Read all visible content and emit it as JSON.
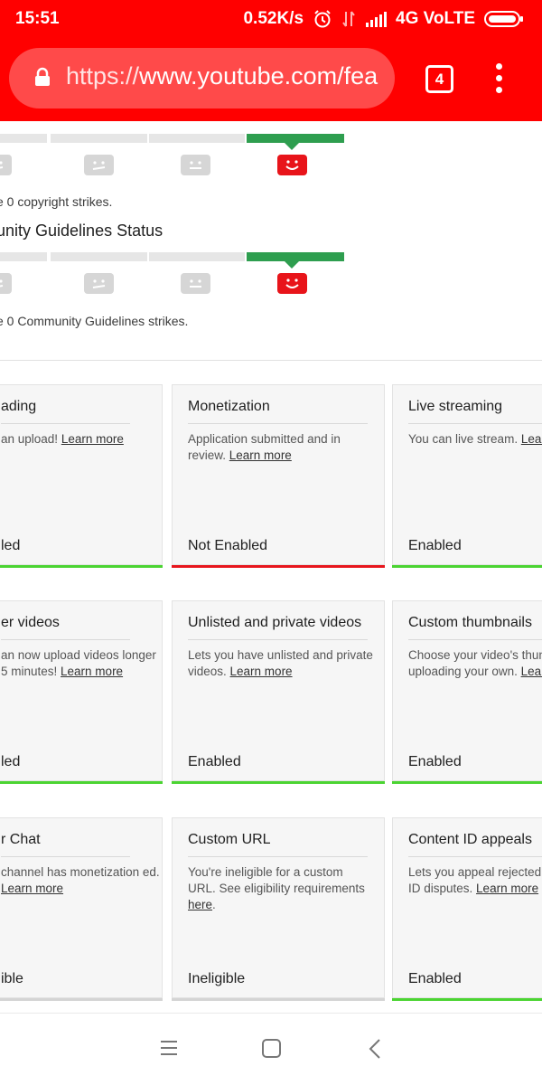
{
  "status_bar": {
    "time": "15:51",
    "speed": "0.52K/s",
    "network": "4G VoLTE"
  },
  "browser": {
    "url_prefix": "https://",
    "url_host": "www.youtube.com/fea",
    "tab_count": "4",
    "icons": [
      "lock-icon",
      "tabs-icon",
      "overflow-menu-icon"
    ]
  },
  "copyright": {
    "strikes_text": "e 0 copyright strikes."
  },
  "community": {
    "title": "unity Guidelines Status",
    "strikes_text": "e 0 Community Guidelines strikes."
  },
  "cards": [
    {
      "title": "ading",
      "desc": "an upload! ",
      "link": "Learn more",
      "status": "led",
      "bar": "green"
    },
    {
      "title": "Monetization",
      "desc": "Application submitted and in review. ",
      "link": "Learn more",
      "status": "Not Enabled",
      "bar": "red"
    },
    {
      "title": "Live streaming",
      "desc": "You can live stream. ",
      "link": "Learn",
      "status": "Enabled",
      "bar": "green"
    },
    {
      "title": "er videos",
      "desc": "an now upload videos longer 5 minutes! ",
      "link": "Learn more",
      "status": "led",
      "bar": "green"
    },
    {
      "title": "Unlisted and private videos",
      "desc": "Lets you have unlisted and private videos. ",
      "link": "Learn more",
      "status": "Enabled",
      "bar": "green"
    },
    {
      "title": "Custom thumbnails",
      "desc": "Choose your video's thumb uploading your own. ",
      "link": "Learn",
      "status": "Enabled",
      "bar": "green"
    },
    {
      "title": "r Chat",
      "desc": "channel has monetization ed. ",
      "link": "Learn more",
      "status": "ible",
      "bar": "gray"
    },
    {
      "title": "Custom URL",
      "desc": "You're ineligible for a custom URL. See eligibility requirements ",
      "link": "here",
      "tail": ".",
      "status": "Ineligible",
      "bar": "gray"
    },
    {
      "title": "Content ID appeals",
      "desc": "Lets you appeal rejected C ID disputes. ",
      "link": "Learn more",
      "status": "Enabled",
      "bar": "green"
    }
  ],
  "colors": {
    "brand_red": "#ff0000",
    "strike_green": "#2e9e4f",
    "enabled_green": "#4bd432",
    "disabled_red": "#e7161d",
    "ineligible_gray": "#d4d4d4"
  },
  "navbar": {
    "icons": [
      "recents-icon",
      "home-icon",
      "back-icon"
    ]
  }
}
